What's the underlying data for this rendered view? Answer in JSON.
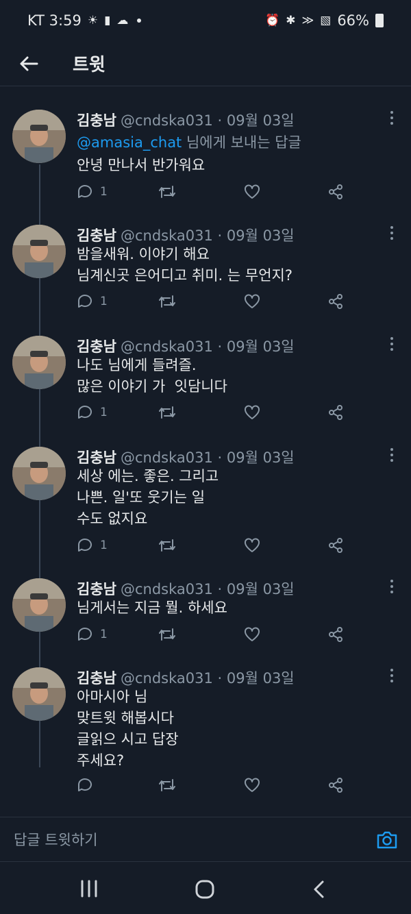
{
  "status_bar": {
    "carrier_time": "KT 3:59",
    "battery": "66%"
  },
  "header": {
    "title": "트윗"
  },
  "tweets": [
    {
      "name": "김충남",
      "handle_date": "@cndska031 · 09월 03일",
      "reply_to_mention": "@amasia_chat",
      "reply_to_suffix": " 님에게 보내는 답글",
      "text": "안녕 만나서 반가워요",
      "reply_count": "1"
    },
    {
      "name": "김충남",
      "handle_date": "@cndska031 · 09월 03일",
      "text": "밤을새워. 이야기 해요\n님계신곳 은어디고 취미. 는 무언지?",
      "reply_count": "1"
    },
    {
      "name": "김충남",
      "handle_date": "@cndska031 · 09월 03일",
      "text": "나도 님에게 들려즐.\n많은 이야기 가  잇담니다",
      "reply_count": "1"
    },
    {
      "name": "김충남",
      "handle_date": "@cndska031 · 09월 03일",
      "text": "세상 에는. 좋은. 그리고\n나쁜. 일'또 웃기는 일\n수도 없지요",
      "reply_count": "1"
    },
    {
      "name": "김충남",
      "handle_date": "@cndska031 · 09월 03일",
      "text": "님게서는 지금 뭘. 하세요",
      "reply_count": "1"
    },
    {
      "name": "김충남",
      "handle_date": "@cndska031 · 09월 03일",
      "text": "아마시아 님\n맞트윗 해봅시다\n글읽으 시고 답장\n주세요?",
      "reply_count": ""
    }
  ],
  "reply_bar": {
    "placeholder": "답글 트윗하기"
  },
  "colors": {
    "background": "#151c27",
    "mention": "#1d9bf0",
    "muted": "#8b98a5",
    "thread_line": "#3b4757"
  },
  "icons": [
    "back-arrow-icon",
    "more-vert-icon",
    "reply-icon",
    "retweet-icon",
    "like-icon",
    "share-icon",
    "camera-icon",
    "recents-icon",
    "home-icon",
    "nav-back-icon"
  ]
}
